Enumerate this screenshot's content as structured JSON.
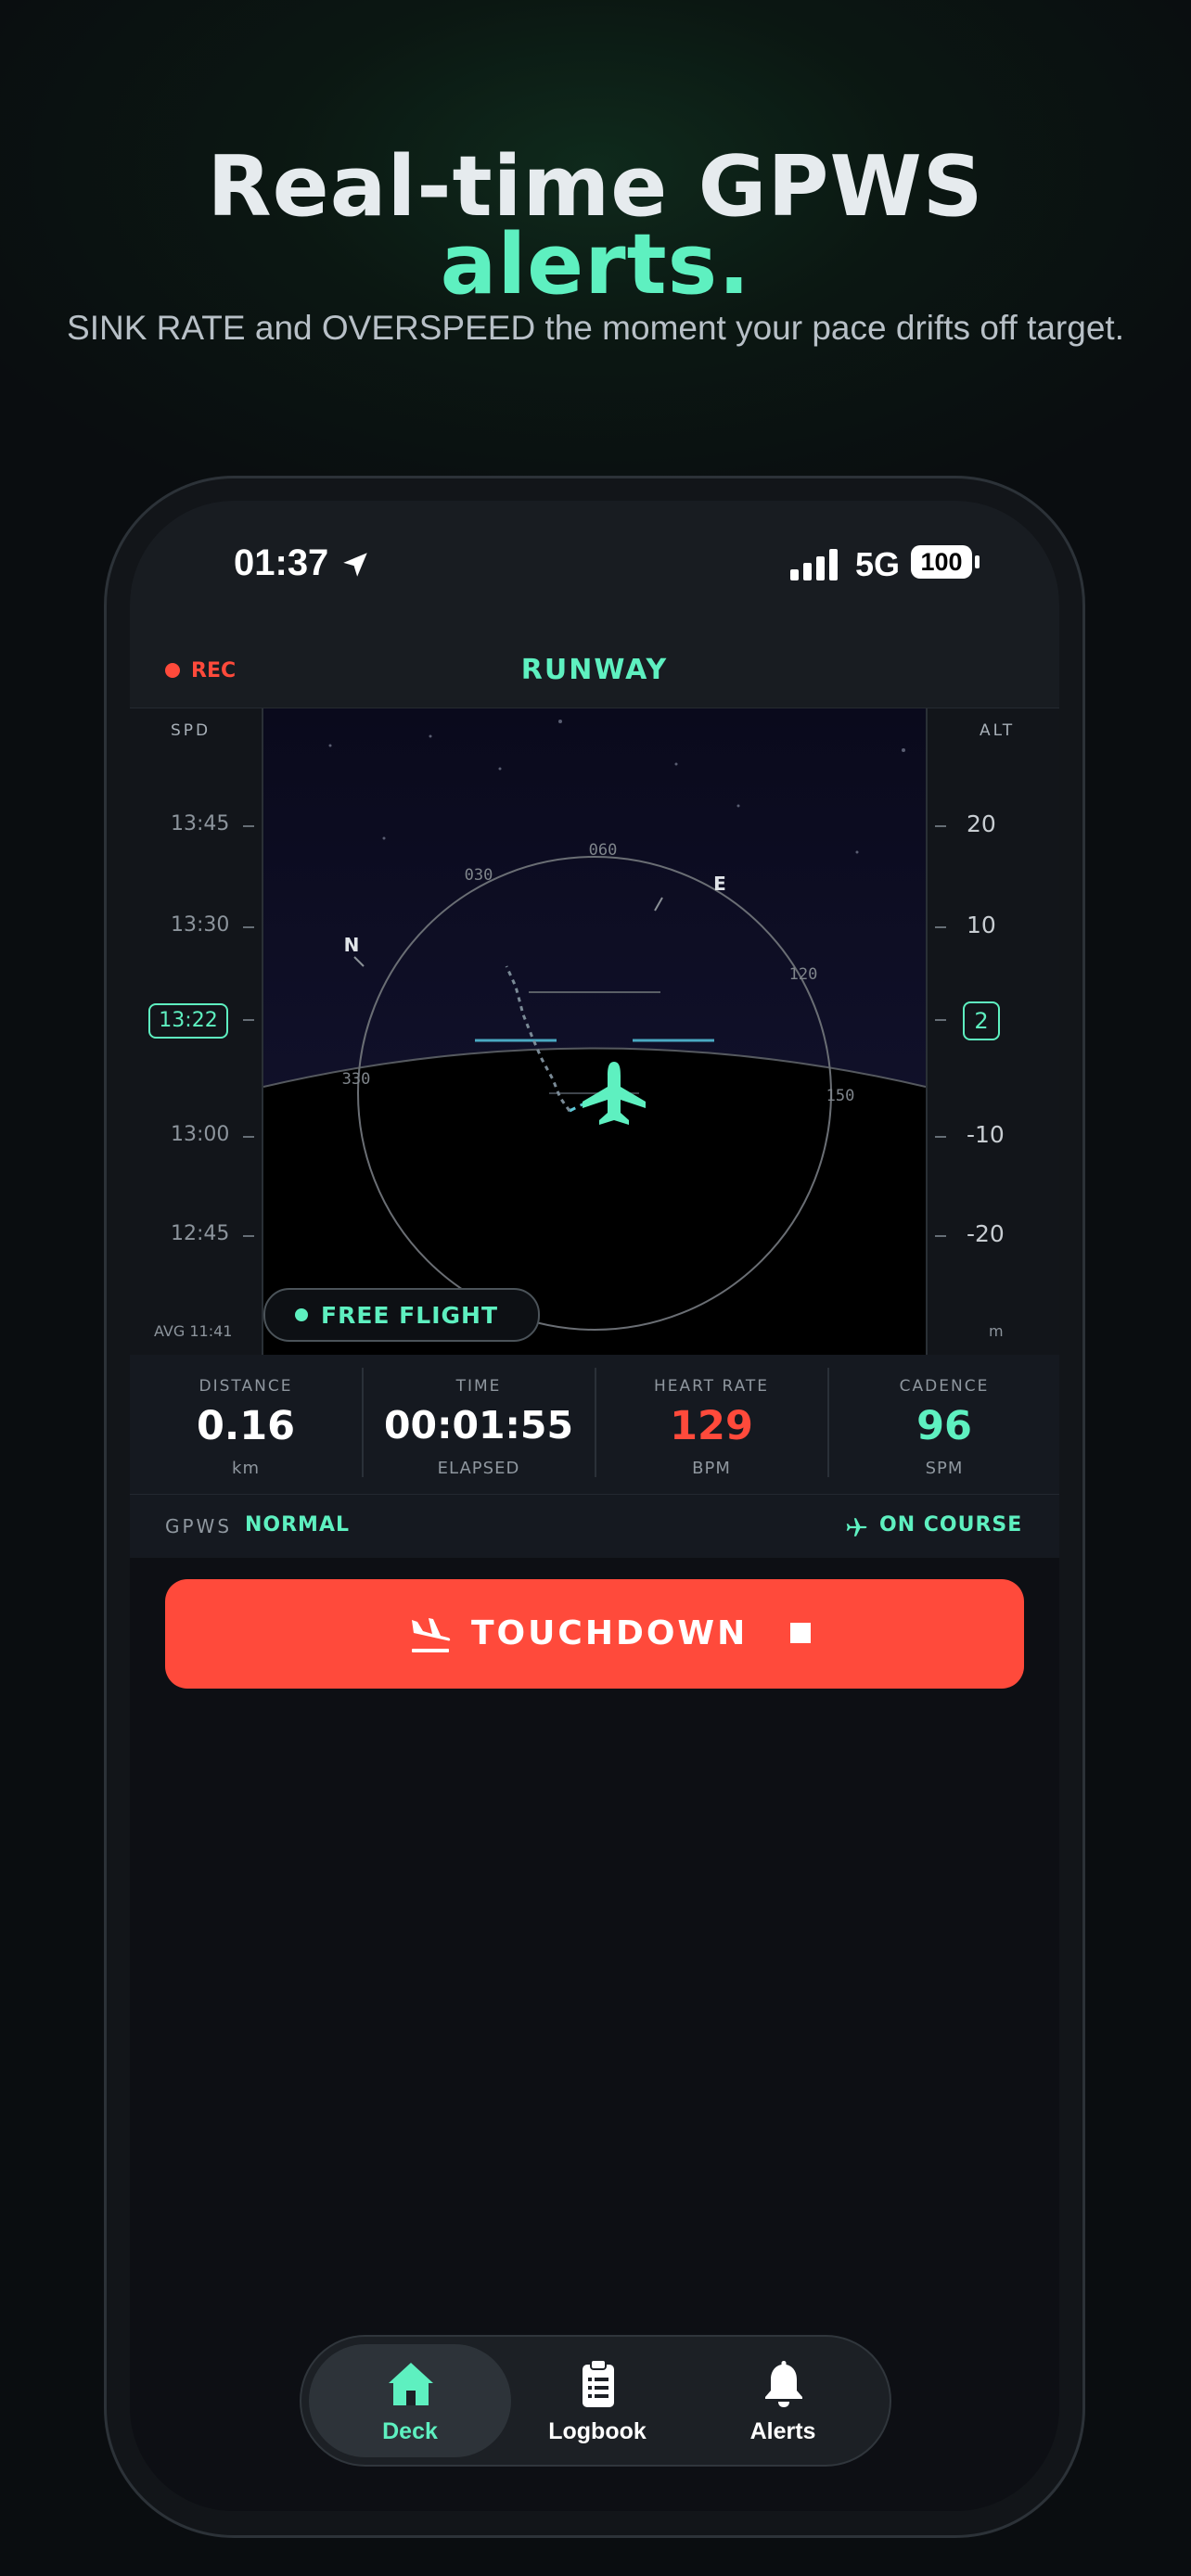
{
  "hero": {
    "title_line1": "Real-time GPWS",
    "title_line2": "alerts.",
    "subtitle": "SINK RATE and OVERSPEED the moment your pace drifts off target."
  },
  "status_bar": {
    "time": "01:37",
    "network": "5G",
    "battery": "100"
  },
  "app_bar": {
    "rec_label": "REC",
    "title": "RUNWAY"
  },
  "hud": {
    "speed_tape": {
      "header": "SPD",
      "ticks": [
        "13:45",
        "13:30",
        "13:00",
        "12:45"
      ],
      "current": "13:22",
      "footer": "AVG 11:41"
    },
    "alt_tape": {
      "header": "ALT",
      "ticks": [
        "20",
        "10",
        "-10",
        "-20"
      ],
      "current": "2",
      "footer": "m"
    },
    "compass": {
      "labels": [
        "030",
        "060",
        "E",
        "120",
        "150",
        "330",
        "N"
      ]
    },
    "mode_pill": "FREE FLIGHT"
  },
  "stats": [
    {
      "header": "DISTANCE",
      "value": "0.16",
      "unit": "km",
      "color": "#ffffff"
    },
    {
      "header": "TIME",
      "value": "00:01:55",
      "unit": "ELAPSED",
      "color": "#ffffff"
    },
    {
      "header": "HEART RATE",
      "value": "129",
      "unit": "BPM",
      "color": "#ff4a3b"
    },
    {
      "header": "CADENCE",
      "value": "96",
      "unit": "SPM",
      "color": "#5ef0c0"
    }
  ],
  "gpws": {
    "label": "GPWS",
    "value": "NORMAL",
    "course": "ON COURSE"
  },
  "action": {
    "label": "TOUCHDOWN"
  },
  "tabs": [
    {
      "label": "Deck",
      "icon": "home-icon",
      "active": true
    },
    {
      "label": "Logbook",
      "icon": "clipboard-icon",
      "active": false
    },
    {
      "label": "Alerts",
      "icon": "bell-icon",
      "active": false
    }
  ],
  "colors": {
    "accent": "#5ef0c0",
    "alert": "#ff4a3b",
    "background": "#0d0f14"
  }
}
